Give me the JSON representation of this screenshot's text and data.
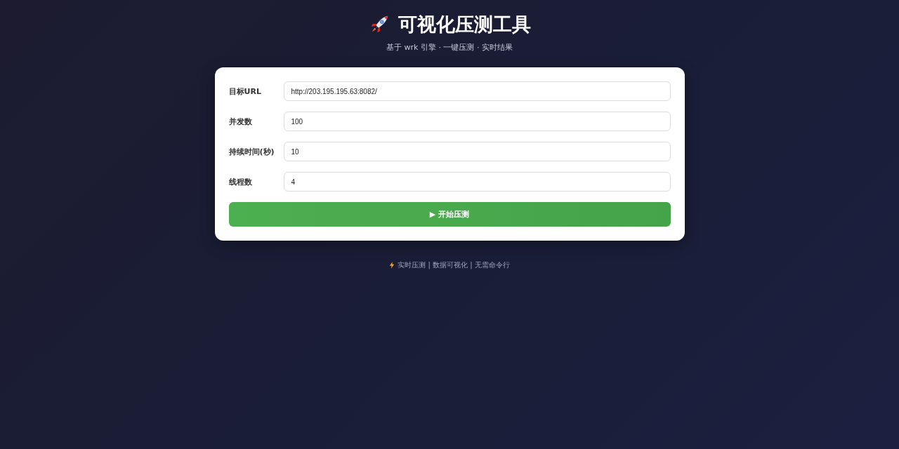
{
  "header": {
    "title": "可视化压测工具",
    "subtitle": "基于 wrk 引擎 · 一键压测 · 实时结果"
  },
  "form": {
    "fields": [
      {
        "label": "目标URL",
        "value": "http://203.195.195.63:8082/"
      },
      {
        "label": "并发数",
        "value": "100"
      },
      {
        "label": "持续时间(秒)",
        "value": "10"
      },
      {
        "label": "线程数",
        "value": "4"
      }
    ],
    "start_button": {
      "label": "▶ 开始压测"
    }
  },
  "footer": {
    "text": "实时压测 | 数据可视化 | 无需命令行"
  }
}
